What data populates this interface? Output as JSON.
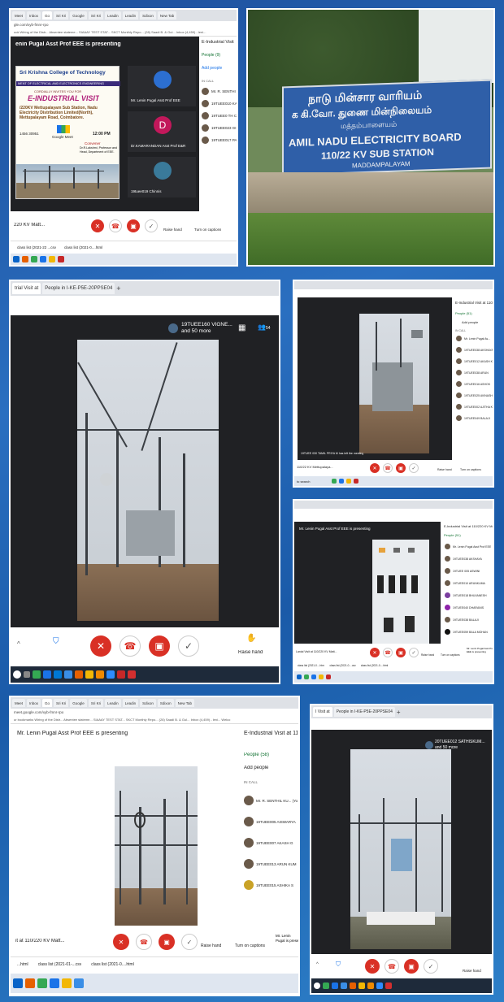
{
  "panel1": {
    "tabs": [
      "Meet",
      "Inbox",
      "Go",
      "Sri Kri",
      "Google",
      "Sri Kri",
      "Leadin",
      "Leadin",
      "Sdixon",
      "New Tab"
    ],
    "url": "gle.com/xyb-fmnr-rpo",
    "bookmarks": "ook   Wiring of the Distr...   Absentee stateme...   SIAAAY TEST STAT...   SKCT Monthly Repo...   (28) Saadi B. & Gul...   Inbox (4,459) - leni...",
    "presenting": "enin Pugal Asst Prof EEE is presenting",
    "side_title": "E-Industrial Visit",
    "people_tab": "People (9)",
    "add_people": "Add people",
    "in_call": "IN CALL",
    "list": [
      "Mr. R. SENTHI",
      "19TUEE010 KAVYA",
      "19TUEE0 TH Ch",
      "19TUEE023 GI",
      "19TUEE017 PA"
    ],
    "tiles": [
      "Mr. Lenin Pugal Asst Prof EEE",
      "Dr.KAMARANDAN Asst Prof E&R",
      "19tuee019 Chinnis"
    ],
    "tile_initial": "D",
    "poster": {
      "college": "Sri Krishna College of Technology",
      "dept": "MENT OF ELECTRICAL AND ELECTRONICS ENGINEERING",
      "invite": "CORDIALLY INVITES YOU FOR",
      "event": "E-INDUSTRIAL VISIT",
      "venue": "/220KV Mettupalayam Sub Station, Nadu Electricity Distribution Limited(North), Mettupalayam Road, Coimbatore.",
      "date": "1456 30951",
      "platform": "Google Meet",
      "time": "12:00 PM",
      "convener": "Convener",
      "convener_name": "Dr.R.Lakshmi, Professor and Head, Department of EEE."
    },
    "meeting_title": "220 KV Matt...",
    "raise_hand": "Raise hand",
    "captions": "Turn on captions",
    "downloads": [
      "class list (2021-22 ...csv",
      "class list (2021-0....html"
    ]
  },
  "panel2": {
    "tamil_line1": "நாடு மின்சார வாரியம்",
    "tamil_line2": "க கி.வோ. துணை மின்நிலையம்",
    "tamil_line3": "மத்தம்பாளையம்",
    "english_line1": "AMIL NADU ELECTRICITY BOARD",
    "english_line2": "110/22 KV  SUB STATION",
    "english_line3": "MADDAMPALAYAM"
  },
  "panel3": {
    "tabs": [
      "trial Visit at",
      "People in I-KE-P5E-20PPSE04"
    ],
    "participants": "19TUEE160 VIGNE... and 50 more",
    "count": "54",
    "raise_hand": "Raise hand"
  },
  "panel4": {
    "side_title": "E-Industrial Visit at 110/2",
    "people_tab": "People (51)",
    "add": "Add people",
    "in_call": "IN CALL",
    "list": [
      "Mr. Lenin Pugal As...",
      "19TUEE038 AKSHAYA",
      "19TUEE012 AKASH K",
      "19TUEE038 ARUN",
      "19TUEE016 ASHOK",
      "19TUEE025 AVINASH",
      "19TUEE002 AJITHA K",
      "19TUEE049 BALAJI"
    ],
    "meeting_title": "110/22 KV Mettupalaya...",
    "raise_hand": "Raise hand",
    "captions": "Turn on captions",
    "caption_strip": "19TUEE 030 TAMIL PRIYA M has left the meeting",
    "search": "to search"
  },
  "panel5": {
    "presenting": "Mr. Lenin Pugal Asst Prof EEE is presenting",
    "side_title": "E-Industrial Visit at 110/220 KV Mettu",
    "people_tab": "People (51)",
    "list": [
      "Mr. Lenin Pugal Asst Prof EEE",
      "19TUEE038 AKSHAYA",
      "19TUEE 005 ASWINI",
      "19TUEE010 ARUNKUMA",
      "19TUEE018 BHUVANESH",
      "19TUEE040 DHARANIS",
      "19TUEE038 BALAJI",
      "19TUEE059 BALA MOHAN"
    ],
    "meeting_title": "Lanial Visit at 110/220 KV Matt...",
    "raise_hand": "Raise hand",
    "captions": "Turn on captions",
    "presenter": "Mr. Lenin Pugal Asst Prof EEE is presenting",
    "caption_strip": "19TUEE 030 TAMIL PRIYA M has left the meeting",
    "downloads": [
      "class list (2021-0....html",
      "class list (2021-0....csv",
      "class list (2021-0....html"
    ]
  },
  "panel6": {
    "tabs": [
      "Meet",
      "Inbox",
      "Go",
      "Sri Kri",
      "Google",
      "Sri Kri",
      "Leadin",
      "Leadin",
      "Sdixon",
      "Sdixon",
      "New Tab"
    ],
    "url": "meet.google.com/xyb-fmnr-rpo",
    "bookmarks": "ur bookmarks   Wiring of the Distr...   Absentee stateme...   SIAAAY TEST STAT...   SKCT Monthly Repo...   (28) Saadi B. & Gul...   Inbox (4,459) - leni...   Welco",
    "presenting": "Mr. Lenin Pugal Asst Prof EEE is presenting",
    "side_title": "E-Industrial Visit at 110/2",
    "people_tab": "People (58)",
    "add_people": "Add people",
    "in_call": "IN CALL",
    "list": [
      "Mr. R. SENTHIL KU... (Yo",
      "19TUEE005 AISWARYA",
      "19TUEE007 AKASH G",
      "19TUEE013 ARUN KUM",
      "19TUEE015 ASHIKA S"
    ],
    "meeting_title": "it at 110/220 KV Matt...",
    "raise_hand": "Raise hand",
    "captions": "Turn on captions",
    "presenter": "Mr. Lenin Pugal is prese",
    "downloads": [
      "...html",
      "class list (2021-01-...csv",
      "class list (2021-0....html"
    ]
  },
  "panel7": {
    "tabs": [
      "I Visit at",
      "People in I-KE-P5E-20PPSE04"
    ],
    "participants": "20TUEE012 SATHISKUM... and 50 more",
    "raise_hand": "Raise hand"
  },
  "colors": {
    "bg": "#1d4f9c",
    "meet_red": "#d93025",
    "stage": "#202124"
  }
}
